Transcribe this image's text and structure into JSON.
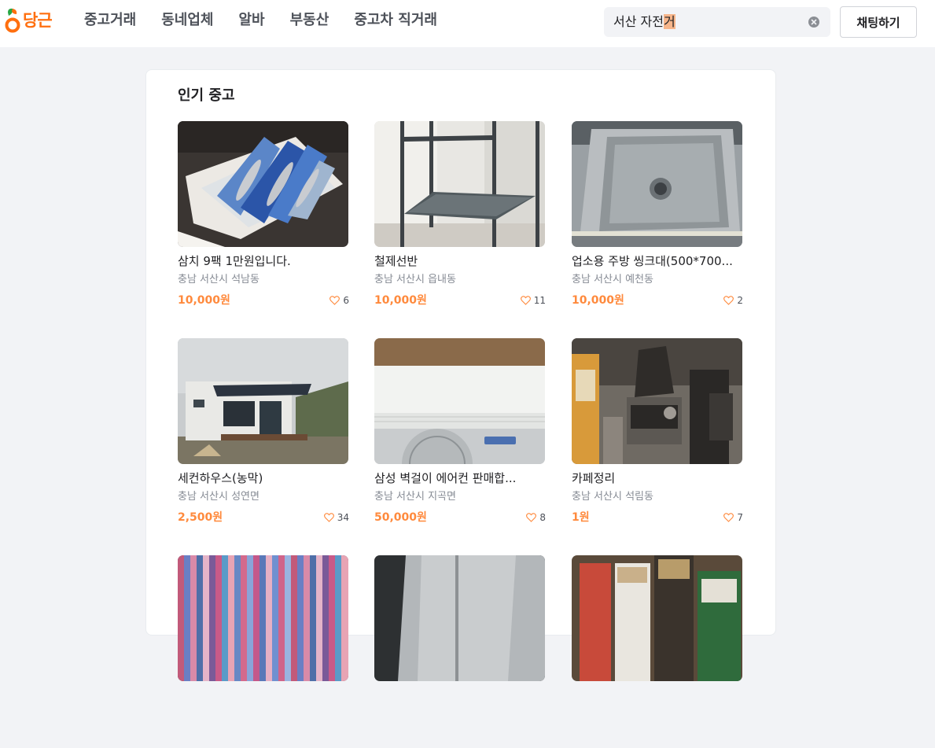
{
  "header": {
    "logo_text": "당근",
    "nav": [
      "중고거래",
      "동네업체",
      "알바",
      "부동산",
      "중고차 직거래"
    ],
    "search": {
      "value": "서산 자전",
      "composing": "거"
    },
    "chat_button": "채팅하기"
  },
  "section": {
    "title": "인기 중고",
    "items": [
      {
        "title": "삼치 9팩 1만원입니다.",
        "region": "충남 서산시 석남동",
        "price": "10,000원",
        "likes": "6",
        "image": "fish-in-styrofoam-box"
      },
      {
        "title": "철제선반",
        "region": "충남 서산시 읍내동",
        "price": "10,000원",
        "likes": "11",
        "image": "metal-shelf"
      },
      {
        "title": "업소용 주방 씽크대(500*700...",
        "region": "충남 서산시 예천동",
        "price": "10,000원",
        "likes": "2",
        "image": "steel-sink"
      },
      {
        "title": "세컨하우스(농막)",
        "region": "충남 서산시 성연면",
        "price": "2,500원",
        "likes": "34",
        "image": "small-house"
      },
      {
        "title": "삼성 벽걸이 에어컨 판매합...",
        "region": "충남 서산시 지곡면",
        "price": "50,000원",
        "likes": "8",
        "image": "wall-air-conditioner"
      },
      {
        "title": "카페정리",
        "region": "충남 서산시 석림동",
        "price": "1원",
        "likes": "7",
        "image": "cafe-equipment"
      },
      {
        "image": "book-spines"
      },
      {
        "image": "metal-sheet"
      },
      {
        "image": "paint-cans"
      }
    ]
  },
  "colors": {
    "brand": "#ff6f0f",
    "price": "#ff8a3d",
    "background": "#f2f3f6"
  }
}
